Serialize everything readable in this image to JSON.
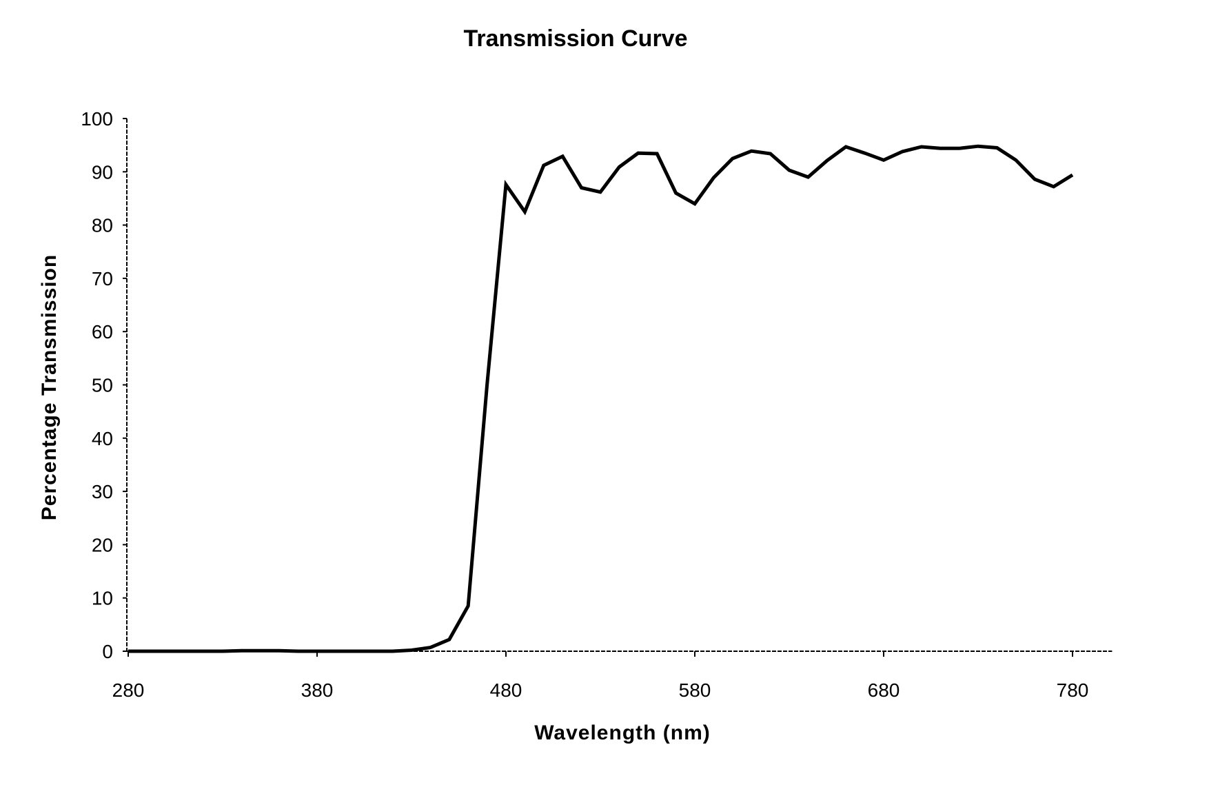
{
  "chart_data": {
    "type": "line",
    "title": "Transmission Curve",
    "xlabel": "Wavelength (nm)",
    "ylabel": "Percentage Transmission",
    "xlim": [
      280,
      790
    ],
    "ylim": [
      0,
      100
    ],
    "xticks": [
      280,
      380,
      480,
      580,
      680,
      780
    ],
    "xtick_labels": [
      "280",
      "380",
      "480",
      "580",
      "680",
      "780"
    ],
    "yticks": [
      0,
      10,
      20,
      30,
      40,
      50,
      60,
      70,
      80,
      90,
      100
    ],
    "ytick_labels": [
      "0",
      "10",
      "20",
      "30",
      "40",
      "50",
      "60",
      "70",
      "80",
      "90",
      "100"
    ],
    "grid": false,
    "legend": null,
    "series": [
      {
        "name": "Transmission",
        "color": "#000000",
        "x": [
          280,
          290,
          300,
          310,
          320,
          330,
          340,
          350,
          360,
          370,
          380,
          390,
          400,
          410,
          420,
          430,
          440,
          450,
          460,
          470,
          480,
          490,
          500,
          510,
          520,
          530,
          540,
          550,
          560,
          570,
          580,
          590,
          600,
          610,
          620,
          630,
          640,
          650,
          660,
          670,
          680,
          690,
          700,
          710,
          720,
          730,
          740,
          750,
          760,
          770,
          780
        ],
        "y": [
          0,
          0,
          0,
          0,
          0,
          0,
          0.1,
          0.1,
          0.1,
          0,
          0,
          0,
          0,
          0,
          0,
          0.2,
          0.7,
          2.2,
          8.5,
          50,
          87.6,
          82.5,
          91.2,
          92.9,
          87.0,
          86.2,
          90.9,
          93.5,
          93.4,
          86.0,
          84.0,
          88.9,
          92.5,
          93.9,
          93.4,
          90.3,
          89.0,
          92.1,
          94.7,
          93.5,
          92.2,
          93.8,
          94.7,
          94.4,
          94.4,
          94.8,
          94.5,
          92.2,
          88.6,
          87.2,
          89.4
        ]
      }
    ]
  }
}
